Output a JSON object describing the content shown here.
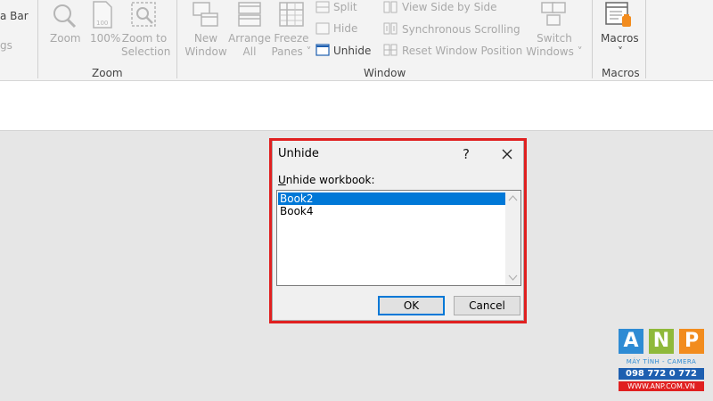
{
  "ribbon": {
    "show_group": {
      "formula_bar": "a Bar",
      "headings": "gs"
    },
    "zoom_group": {
      "label": "Zoom",
      "zoom": "Zoom",
      "zoom_100": "100%",
      "zoom_to_selection_1": "Zoom to",
      "zoom_to_selection_2": "Selection"
    },
    "window_group": {
      "label": "Window",
      "new_window_1": "New",
      "new_window_2": "Window",
      "arrange_all_1": "Arrange",
      "arrange_all_2": "All",
      "freeze_panes_1": "Freeze",
      "freeze_panes_2": "Panes ˅",
      "split": "Split",
      "hide": "Hide",
      "unhide": "Unhide",
      "view_side_by_side": "View Side by Side",
      "sync_scrolling": "Synchronous Scrolling",
      "reset_window_position": "Reset Window Position",
      "switch_windows_1": "Switch",
      "switch_windows_2": "Windows ˅"
    },
    "macros_group": {
      "label": "Macros",
      "macros": "Macros",
      "macros_arrow": "˅"
    }
  },
  "dialog": {
    "title": "Unhide",
    "help": "?",
    "label_underlined": "U",
    "label_rest": "nhide workbook:",
    "workbooks": [
      {
        "name": "Book2",
        "selected": true
      },
      {
        "name": "Book4",
        "selected": false
      }
    ],
    "ok": "OK",
    "cancel": "Cancel"
  },
  "watermark": {
    "letters": [
      "A",
      "N",
      "P"
    ],
    "colors": [
      "#2e8bd4",
      "#8fb93a",
      "#f28c1e"
    ],
    "line1": "MÁY TÍNH - CAMERA",
    "line2": "098 772 0 772",
    "line3": "WWW.ANP.COM.VN"
  }
}
